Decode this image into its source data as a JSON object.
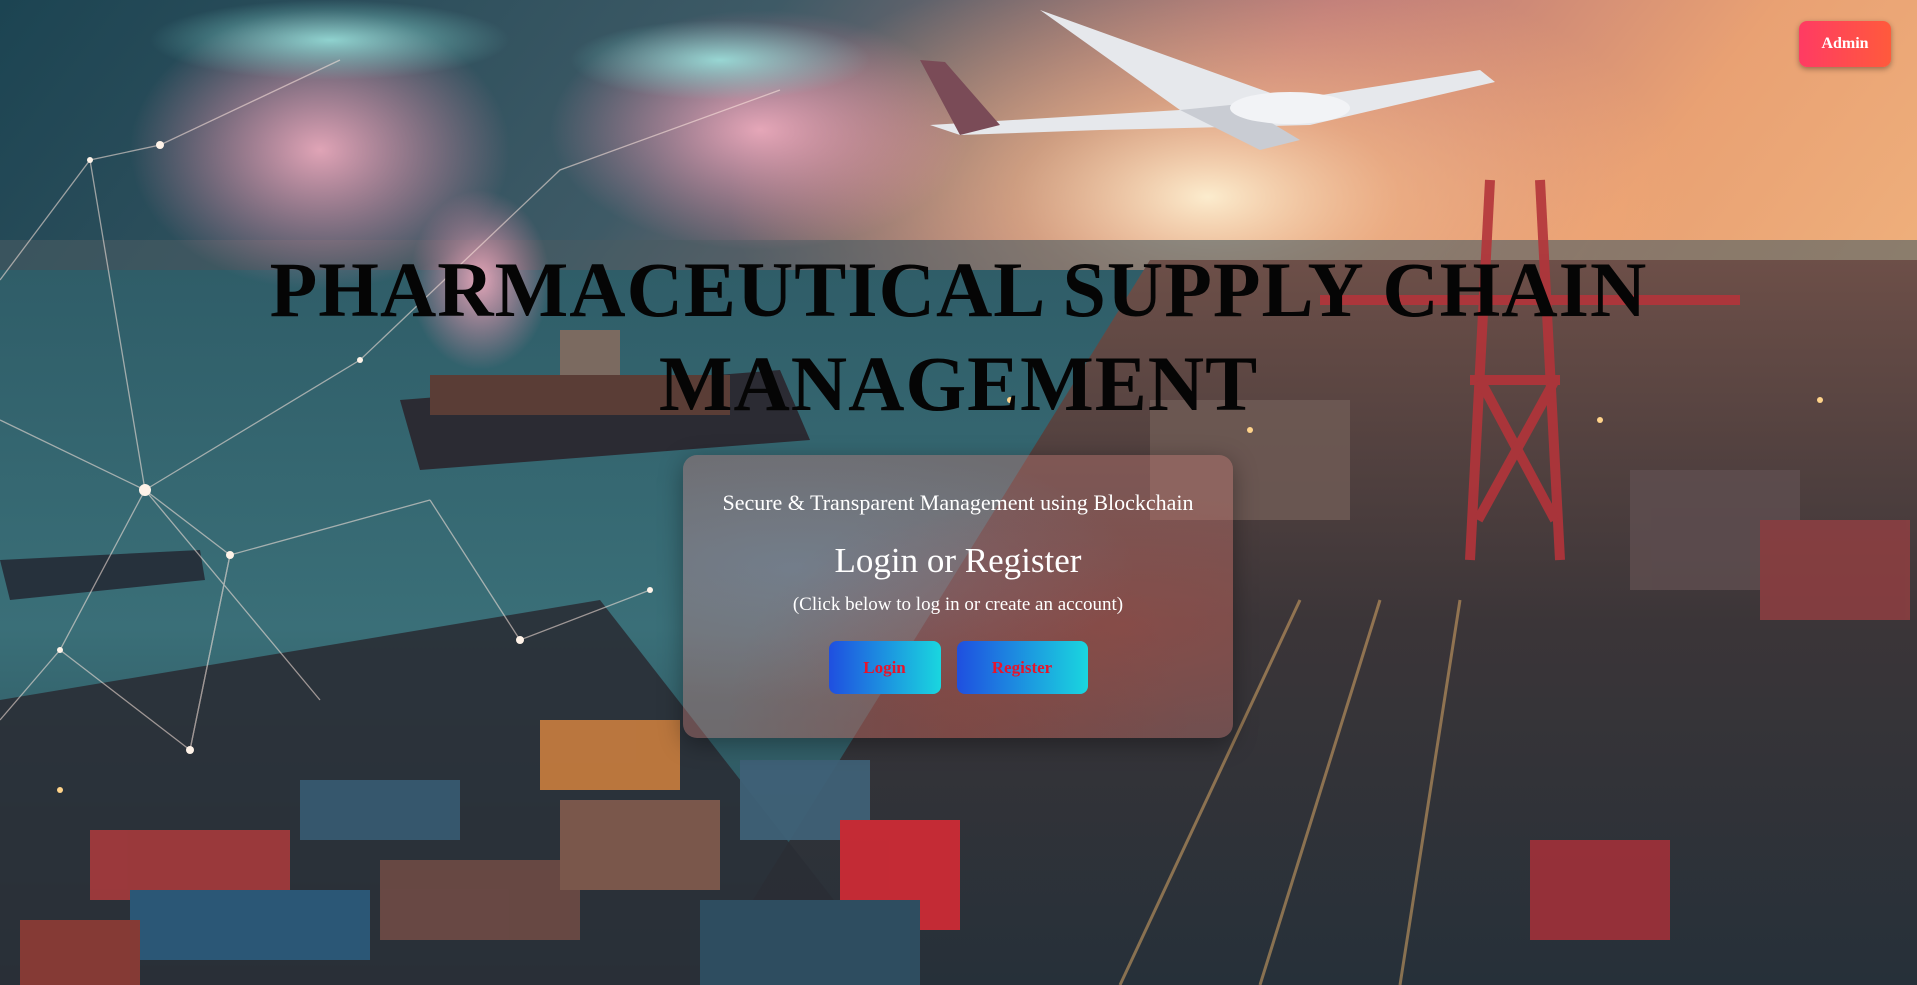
{
  "header": {
    "admin_label": "Admin"
  },
  "hero": {
    "title": "PHARMACEUTICAL SUPPLY CHAIN MANAGEMENT"
  },
  "auth_card": {
    "subtitle": "Secure & Transparent Management using Blockchain",
    "heading": "Login or Register",
    "hint": "(Click below to log in or create an account)",
    "login_label": "Login",
    "register_label": "Register"
  },
  "colors": {
    "admin_button": "#ff4356",
    "auth_button_start": "#1f4fe0",
    "auth_button_end": "#1ad6df",
    "auth_button_text": "#e8142b",
    "title_text": "#050505"
  },
  "icons": {
    "background": "port-logistics-scene-image"
  }
}
